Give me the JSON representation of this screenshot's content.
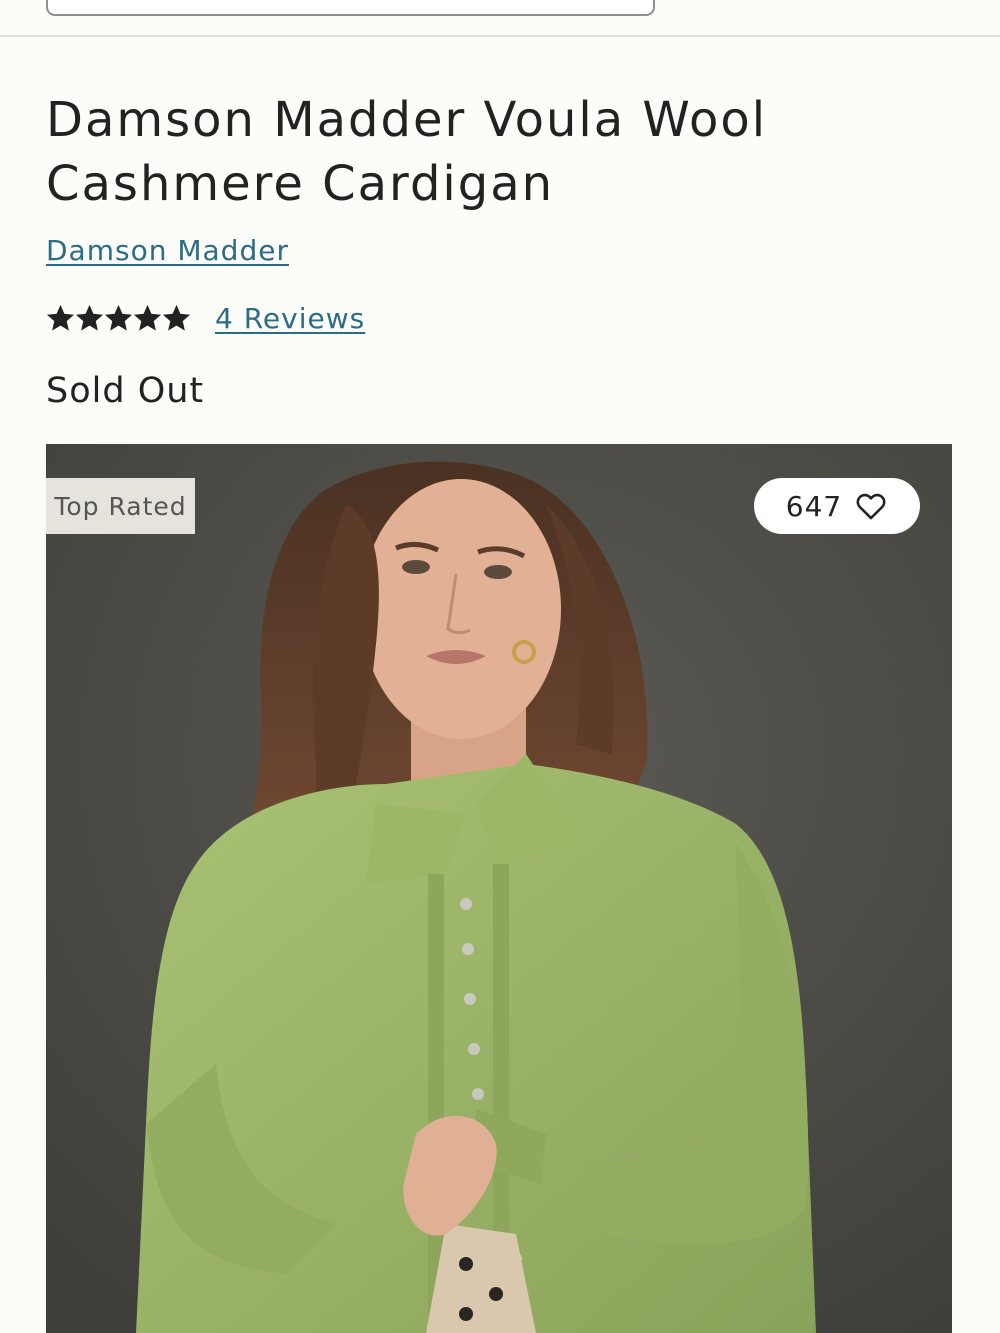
{
  "product": {
    "title": "Damson Madder Voula Wool Cashmere Cardigan",
    "brand": "Damson Madder",
    "rating": 5,
    "rating_max": 5,
    "reviews_label": "4 Reviews",
    "status": "Sold Out"
  },
  "image": {
    "badge": "Top Rated",
    "favorites_count": "647",
    "favorite_icon": "heart-outline-icon",
    "description_hidden": ""
  },
  "colors": {
    "link": "#2b6d86",
    "badge_bg": "#e6e3dd",
    "page_bg": "#fcfcf8",
    "garment": "#9db668"
  }
}
